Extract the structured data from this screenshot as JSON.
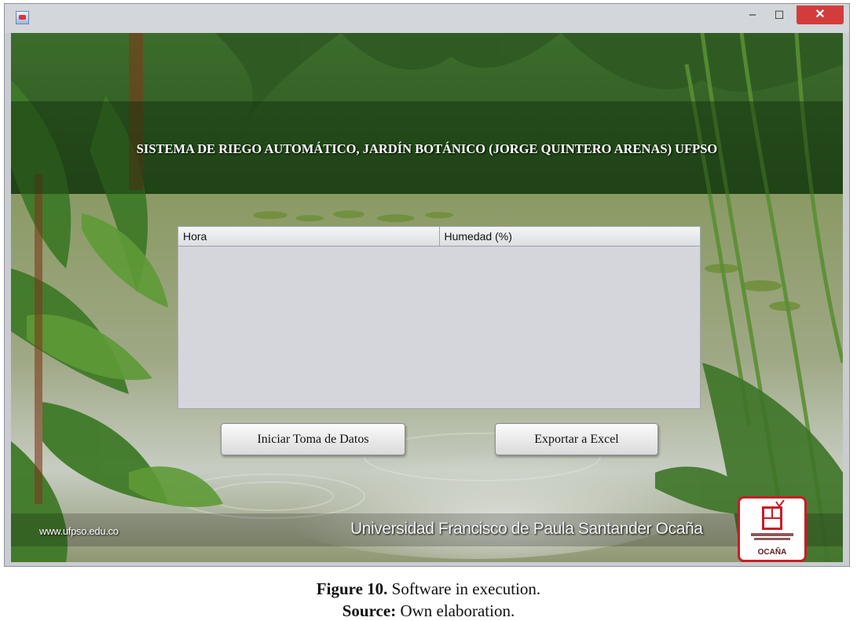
{
  "window": {
    "controls": {
      "minimize": "–",
      "maximize": "☐",
      "close": "✕"
    }
  },
  "header": {
    "title": "SISTEMA DE RIEGO AUTOMÁTICO, JARDÍN BOTÁNICO (JORGE QUINTERO ARENAS) UFPSO"
  },
  "table": {
    "columns": [
      "Hora",
      "Humedad (%)"
    ],
    "rows": []
  },
  "buttons": {
    "start_label": "Iniciar Toma de Datos",
    "export_label": "Exportar a Excel"
  },
  "footer": {
    "website": "www.ufpso.edu.co",
    "university": "Universidad Francisco de Paula Santander Ocaña",
    "logo_caption": "OCAÑA"
  },
  "figure": {
    "label": "Figure 10.",
    "text": "Software in execution.",
    "source_label": "Source:",
    "source_text": "Own elaboration."
  },
  "colors": {
    "close_button": "#d23c3c",
    "logo_red": "#c81d25",
    "table_bg": "#d4d6dc"
  }
}
